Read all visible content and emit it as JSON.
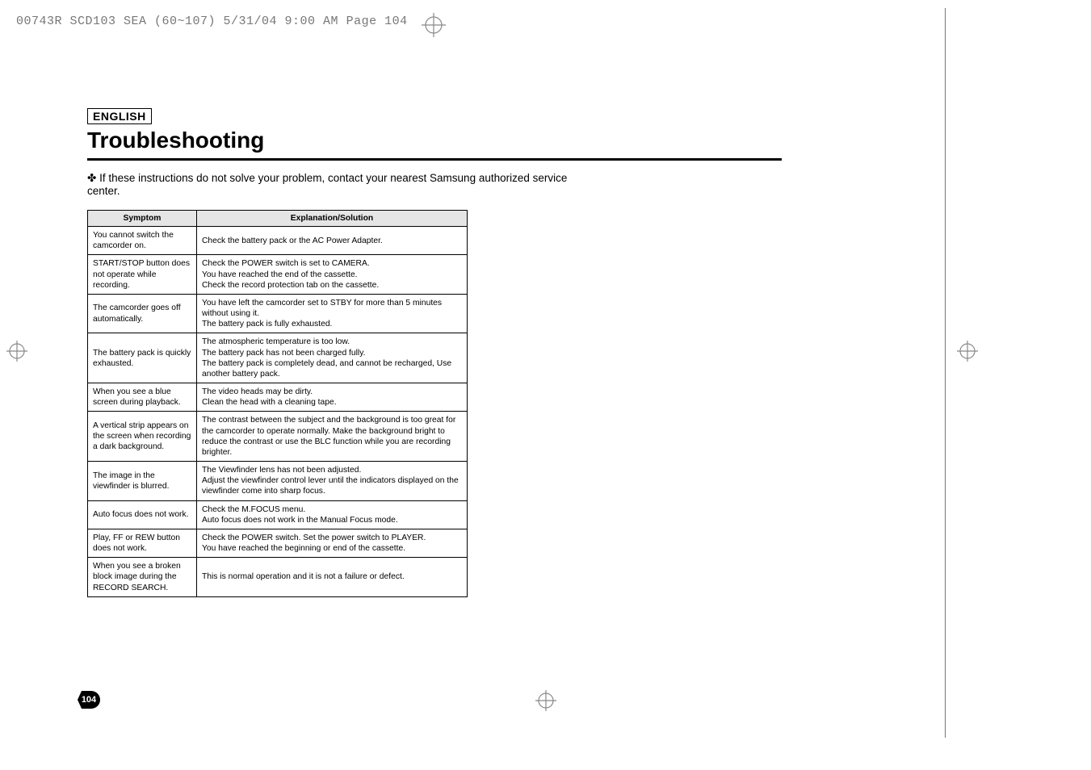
{
  "meta": {
    "header_text": "00743R SCD103 SEA (60~107)  5/31/04 9:00 AM  Page 104"
  },
  "page": {
    "language": "ENGLISH",
    "title": "Troubleshooting",
    "intro_bullet": "✤",
    "intro_text": "If these instructions do not solve your problem, contact your nearest Samsung authorized service center.",
    "page_number": "104"
  },
  "table": {
    "headers": {
      "symptom": "Symptom",
      "explanation": "Explanation/Solution"
    },
    "rows": [
      {
        "symptom": "You cannot switch the camcorder on.",
        "explanation": "Check the battery pack or the AC Power Adapter."
      },
      {
        "symptom": "START/STOP button does not operate while recording.",
        "explanation": "Check the POWER switch is set to CAMERA.\nYou have reached the end of the cassette.\nCheck the record protection tab on the cassette."
      },
      {
        "symptom": "The camcorder goes off automatically.",
        "explanation": "You have left the camcorder set to STBY for more than 5 minutes without using it.\nThe battery pack is fully exhausted."
      },
      {
        "symptom": "The battery pack is quickly exhausted.",
        "explanation": "The atmospheric temperature is too low.\nThe battery pack has not been charged fully.\nThe battery pack is completely dead, and cannot be recharged, Use another battery pack."
      },
      {
        "symptom": "When you see a blue screen during playback.",
        "explanation": "The video heads may be dirty.\nClean the head with a cleaning tape."
      },
      {
        "symptom": "A vertical strip appears on the screen when recording a dark background.",
        "explanation": "The contrast between the subject and the background is too great for the camcorder to operate normally. Make the background bright to reduce the contrast or use the BLC function while you are recording brighter."
      },
      {
        "symptom": "The image in the viewfinder is blurred.",
        "explanation": "The Viewfinder lens has not been adjusted.\nAdjust the viewfinder control lever until the indicators displayed on the viewfinder come into  sharp focus."
      },
      {
        "symptom": "Auto focus does not work.",
        "explanation": "Check the M.FOCUS menu.\nAuto focus does not work in the Manual Focus mode."
      },
      {
        "symptom": "Play, FF or REW button does not work.",
        "explanation": "Check the POWER switch. Set the power switch to PLAYER.\nYou have reached the beginning or end of the cassette."
      },
      {
        "symptom": "When you see a broken block image during the RECORD SEARCH.",
        "explanation": "This is normal operation and it is not a failure or defect."
      }
    ]
  }
}
